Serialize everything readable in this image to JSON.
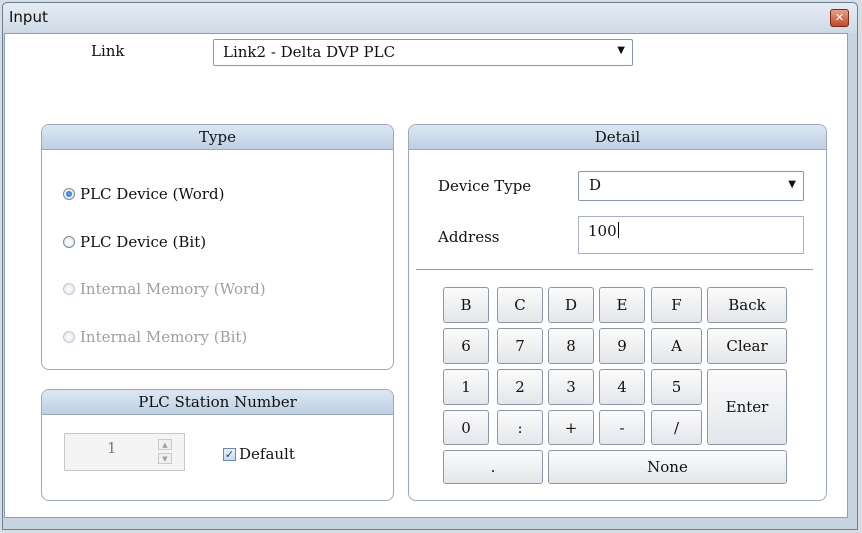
{
  "window": {
    "title": "Input",
    "close_icon": "close-icon"
  },
  "link": {
    "label": "Link",
    "selected": "Link2 - Delta DVP PLC"
  },
  "type_group": {
    "header": "Type",
    "options": [
      {
        "label": "PLC Device (Word)",
        "checked": true,
        "enabled": true
      },
      {
        "label": "PLC Device (Bit)",
        "checked": false,
        "enabled": true
      },
      {
        "label": "Internal Memory (Word)",
        "checked": false,
        "enabled": false
      },
      {
        "label": "Internal Memory (Bit)",
        "checked": false,
        "enabled": false
      }
    ]
  },
  "detail_group": {
    "header": "Detail",
    "device_type_label": "Device Type",
    "device_type_value": "D",
    "address_label": "Address",
    "address_value": "100"
  },
  "keypad": {
    "row1": [
      "B",
      "C",
      "D",
      "E",
      "F",
      "Back"
    ],
    "row2": [
      "6",
      "7",
      "8",
      "9",
      "A",
      "Clear"
    ],
    "row3": [
      "1",
      "2",
      "3",
      "4",
      "5"
    ],
    "row4": [
      "0",
      ":",
      "+",
      "-",
      "/"
    ],
    "enter": "Enter",
    "dot": ".",
    "none": "None"
  },
  "station_group": {
    "header": "PLC Station Number",
    "value": "1",
    "default_label": "Default",
    "default_checked": true
  }
}
